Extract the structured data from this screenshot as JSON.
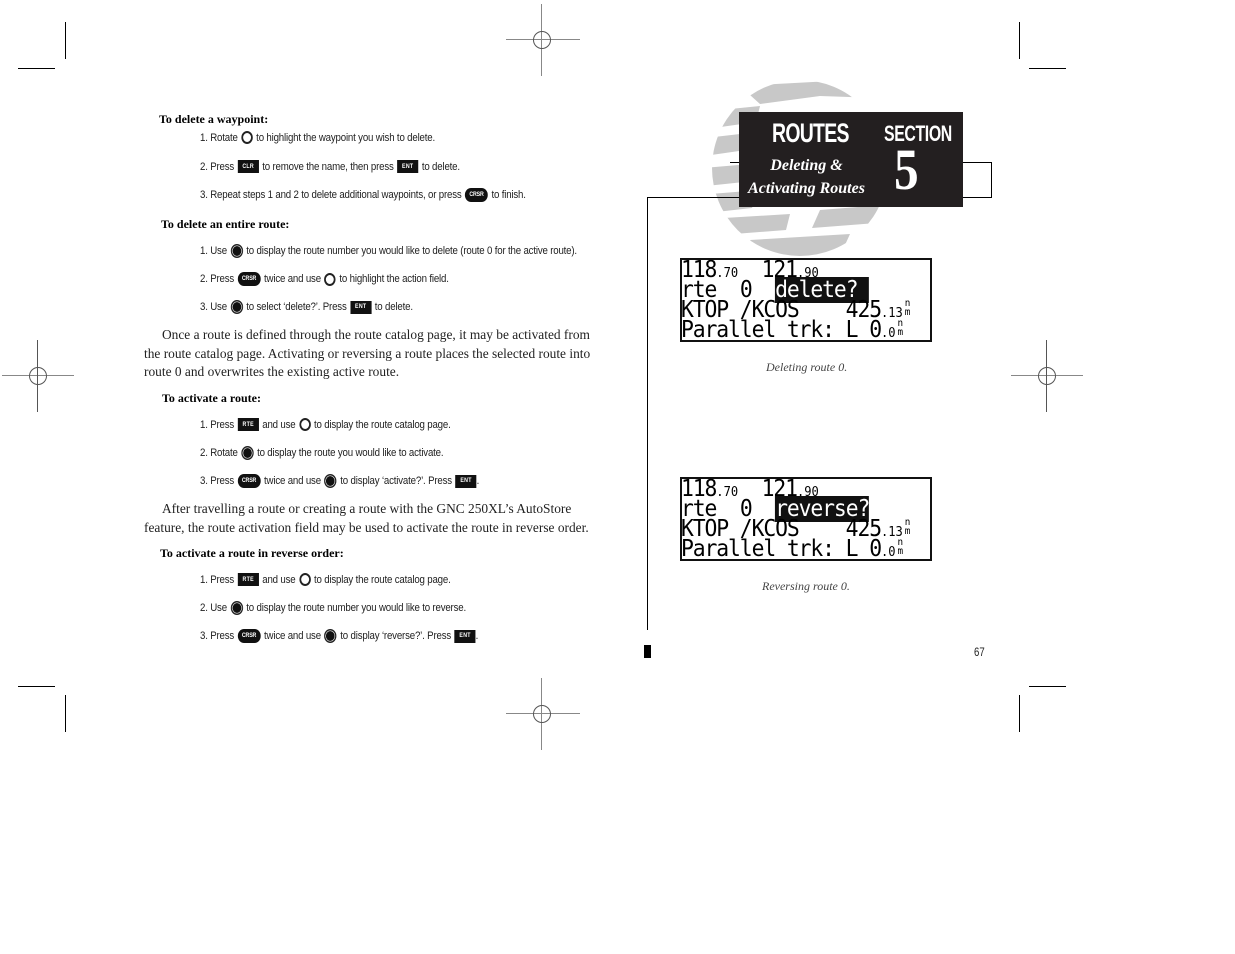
{
  "document": {
    "manual": "GNC 250XL",
    "page_number": "67"
  },
  "section_tab": {
    "title": "ROUTES",
    "subtitle_line1": "Deleting &",
    "subtitle_line2": "Activating Routes",
    "section_label": "SECTION",
    "section_number": "5"
  },
  "left_column": {
    "delete_waypoint": {
      "heading": "To delete a waypoint:",
      "steps": [
        {
          "prefix": "1. Rotate",
          "icon": "knob-outline-icon",
          "suffix": "to highlight the waypoint you wish to delete."
        },
        {
          "prefix": "2. Press",
          "icon": "CLR",
          "middle": "to remove the name, then press",
          "icon2": "ENT",
          "suffix": "to delete."
        },
        {
          "prefix": "3. Repeat steps 1 and 2 to delete additional waypoints, or press",
          "icon": "CRSR",
          "suffix": "to finish."
        }
      ]
    },
    "delete_route": {
      "heading": "To delete an entire route:",
      "steps": [
        {
          "prefix": "1. Use",
          "icon": "knob-filled-icon",
          "suffix": "to display the route number you would like to delete (route 0 for the active route)."
        },
        {
          "prefix": "2. Press",
          "icon": "CRSR",
          "middle": "twice and use",
          "icon2": "knob-outline-icon",
          "suffix": "to highlight the action field."
        },
        {
          "prefix": "3. Use",
          "icon": "knob-filled-icon",
          "middle": "to select ‘delete?’. Press",
          "icon2": "ENT",
          "suffix": "to delete."
        }
      ]
    },
    "paragraph1": "Once a route is defined through the route catalog page, it may be activated from the route catalog page. Activating or reversing a route places the selected route into route 0 and overwrites the existing active route.",
    "activate_route": {
      "heading": "To activate a route:",
      "steps": [
        {
          "prefix": "1. Press",
          "icon": "RTE",
          "middle": "and use",
          "icon2": "knob-outline-icon",
          "suffix": "to display the route catalog page."
        },
        {
          "prefix": "2. Rotate",
          "icon": "knob-filled-icon",
          "suffix": "to display the route you would like to activate."
        },
        {
          "prefix": "3. Press",
          "icon": "CRSR",
          "middle": "twice and use",
          "icon2": "knob-filled-icon",
          "middle2": "to display ‘activate?’. Press",
          "icon3": "ENT",
          "suffix": "."
        }
      ]
    },
    "paragraph2": "After travelling a route or creating a route with the GNC 250XL’s AutoStore feature, the route activation field may be used to activate the route in reverse order.",
    "reverse_route": {
      "heading": "To activate a route in reverse order:",
      "steps": [
        {
          "prefix": "1. Press",
          "icon": "RTE",
          "middle": "and use",
          "icon2": "knob-outline-icon",
          "suffix": "to display the route catalog page."
        },
        {
          "prefix": "2. Use",
          "icon": "knob-filled-icon",
          "suffix": "to display the route number you would like to reverse."
        },
        {
          "prefix": "3. Press",
          "icon": "CRSR",
          "middle": "twice and use",
          "icon2": "knob-filled-icon",
          "middle2": "to display ‘reverse?’. Press",
          "icon3": "ENT",
          "suffix": "."
        }
      ]
    }
  },
  "screens": [
    {
      "freq1_main": "118",
      "freq1_dec": ".70",
      "freq2_main": "121",
      "freq2_dec": ".90",
      "route_label": "rte",
      "route_num": "0",
      "action": "delete?",
      "route_name": "KTOP /KCOS",
      "distance_main": "425",
      "distance_dec": ".13",
      "distance_unit_top": "n",
      "distance_unit_bottom": "m",
      "parallel_label": "Parallel trk:",
      "parallel_dir": "L",
      "parallel_main": "0",
      "parallel_dec": ".0",
      "parallel_unit_top": "n",
      "parallel_unit_bottom": "m",
      "caption": "Deleting route 0."
    },
    {
      "freq1_main": "118",
      "freq1_dec": ".70",
      "freq2_main": "121",
      "freq2_dec": ".90",
      "route_label": "rte",
      "route_num": "0",
      "action": "reverse?",
      "route_name": "KTOP /KCOS",
      "distance_main": "425",
      "distance_dec": ".13",
      "distance_unit_top": "n",
      "distance_unit_bottom": "m",
      "parallel_label": "Parallel trk:",
      "parallel_dir": "L",
      "parallel_main": "0",
      "parallel_dec": ".0",
      "parallel_unit_top": "n",
      "parallel_unit_bottom": "m",
      "caption": "Reversing route 0."
    }
  ],
  "key_labels": {
    "clr": "CLR",
    "ent": "ENT",
    "crsr": "CRSR",
    "rte": "RTE"
  },
  "colors": {
    "tab_background": "#231f20",
    "globe_gray": "#c8c8c8",
    "text": "#222222"
  }
}
